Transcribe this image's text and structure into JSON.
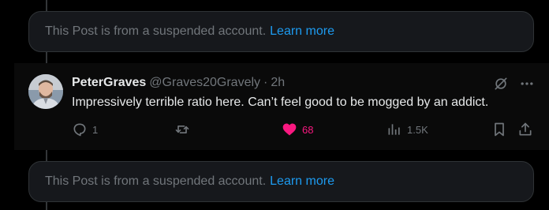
{
  "suspended_notice": {
    "text": "This Post is from a suspended account.",
    "link": "Learn more"
  },
  "post": {
    "display_name": "PeterGraves",
    "handle": "@Graves20Gravely",
    "separator": "·",
    "time": "2h",
    "text": "Impressively terrible ratio here. Can’t feel good to be mogged by an addict.",
    "replies": "1",
    "likes": "68",
    "views": "1.5K",
    "liked": true
  },
  "colors": {
    "background": "#000000",
    "card": "#16181c",
    "accent": "#1d9bf0",
    "like": "#f91880",
    "muted": "#71767b"
  }
}
